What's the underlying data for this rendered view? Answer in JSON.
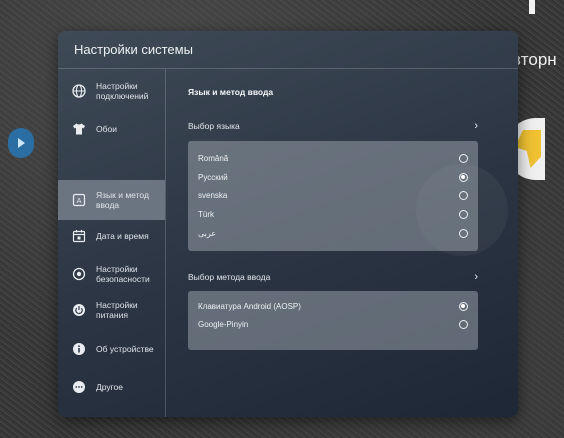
{
  "background": {
    "title_fragment": "зторн"
  },
  "panel": {
    "title": "Настройки системы"
  },
  "sidebar": {
    "items": [
      {
        "label": "Настройки\nподключений",
        "icon": "globe-icon"
      },
      {
        "label": "Обои",
        "icon": "shirt-icon"
      },
      {
        "label": "Язык и метод\nввода",
        "icon": "keyboard-a-icon",
        "active": true
      },
      {
        "label": "Дата и время",
        "icon": "calendar-icon"
      },
      {
        "label": "Настройки\nбезопасности",
        "icon": "shield-icon"
      },
      {
        "label": "Настройки\nпитания",
        "icon": "power-icon"
      },
      {
        "label": "Об устройстве",
        "icon": "info-icon"
      },
      {
        "label": "Другое",
        "icon": "more-icon"
      }
    ]
  },
  "main": {
    "section_title": "Язык и метод ввода",
    "language_select_label": "Выбор языка",
    "languages": [
      {
        "label": "Română",
        "checked": false
      },
      {
        "label": "Русский",
        "checked": true
      },
      {
        "label": "svenska",
        "checked": false
      },
      {
        "label": "Türk",
        "checked": false
      },
      {
        "label": "عربى",
        "checked": false
      }
    ],
    "input_method_label": "Выбор метода ввода",
    "input_methods": [
      {
        "label": "Клавиатура Android (AOSP)",
        "checked": true
      },
      {
        "label": "Google-Pinyin",
        "checked": false
      }
    ]
  },
  "colors": {
    "active_item": "#6b7582",
    "accent_handle": "#2a6ea3"
  }
}
